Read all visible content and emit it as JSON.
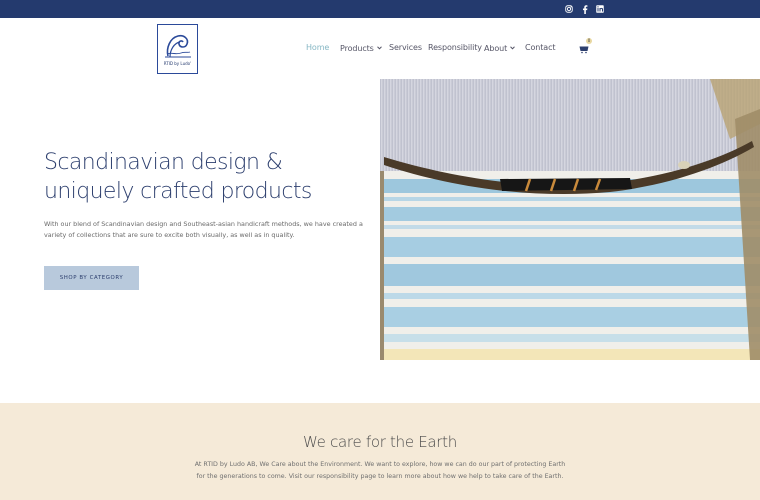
{
  "topbar": {
    "social": [
      {
        "icon": "instagram-icon"
      },
      {
        "icon": "facebook-icon"
      },
      {
        "icon": "linkedin-icon"
      }
    ]
  },
  "header": {
    "logo_text": "RTID by Ludo'",
    "nav": [
      {
        "label": "Home",
        "active": true
      },
      {
        "label": "Products",
        "dropdown": true
      },
      {
        "label": "Services"
      },
      {
        "label": "Responsibility"
      },
      {
        "label": "About",
        "dropdown": true
      },
      {
        "label": "Contact"
      }
    ],
    "cart_count": "0"
  },
  "hero": {
    "title": "Scandinavian design & uniquely crafted products",
    "text": "With our blend of Scandinavian design and Southeast-asian handicraft methods, we have created a variety of collections that are sure to excite both visually, as well as in quality.",
    "button": "SHOP BY CATEGORY"
  },
  "earth": {
    "title": "We care for the Earth",
    "text": "At RTID by Ludo AB, We Care about the Environment. We want to explore, how we can do our part of protecting Earth for the generations to come. Visit our responsibility page to learn more about how we help to take care of the Earth."
  },
  "colors": {
    "topbar": "#243a6e",
    "nav_active": "#86b7c4",
    "button_bg": "#b8c9dc",
    "earth_bg": "#f5ead8"
  }
}
